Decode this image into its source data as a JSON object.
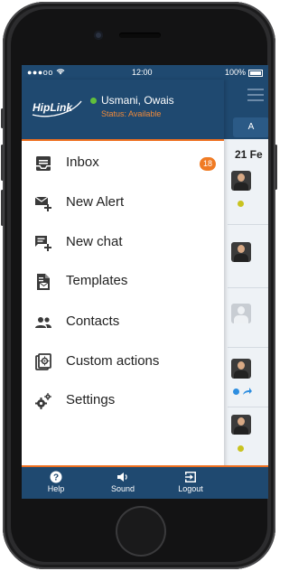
{
  "status_bar": {
    "carrier": "●●●oo",
    "time": "12:00",
    "battery": "100%"
  },
  "profile": {
    "logo_text": "HipLink",
    "user_name": "Usmani, Owais",
    "status": "Status: Available"
  },
  "menu": {
    "items": [
      {
        "label": "Inbox",
        "icon": "inbox-icon",
        "badge": "18"
      },
      {
        "label": "New Alert",
        "icon": "new-alert-icon"
      },
      {
        "label": "New chat",
        "icon": "new-chat-icon"
      },
      {
        "label": "Templates",
        "icon": "templates-icon"
      },
      {
        "label": "Contacts",
        "icon": "contacts-icon"
      },
      {
        "label": "Custom actions",
        "icon": "custom-actions-icon"
      },
      {
        "label": "Settings",
        "icon": "settings-icon"
      }
    ]
  },
  "background": {
    "tab_label": "A",
    "date": "21 Fe"
  },
  "bottom_bar": {
    "help": "Help",
    "sound": "Sound",
    "logout": "Logout"
  },
  "colors": {
    "header_blue": "#1f4970",
    "accent_orange": "#ee6f1f",
    "online_green": "#61c03b",
    "unread_dot": "#c9c320"
  }
}
